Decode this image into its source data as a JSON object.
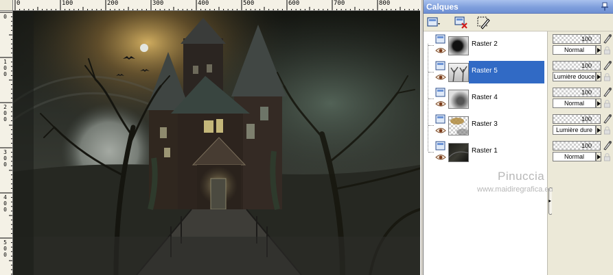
{
  "palette": {
    "title": "Calques",
    "layers": [
      {
        "name": "Raster 2",
        "opacity": "100",
        "blend_mode": "Normal",
        "selected": false,
        "thumb": "dark-smoke"
      },
      {
        "name": "Raster 5",
        "opacity": "100",
        "blend_mode": "Lumière douce",
        "selected": true,
        "thumb": "white-trees"
      },
      {
        "name": "Raster 4",
        "opacity": "100",
        "blend_mode": "Normal",
        "selected": false,
        "thumb": "grey-haze"
      },
      {
        "name": "Raster 3",
        "opacity": "100",
        "blend_mode": "Lumière dure",
        "selected": false,
        "thumb": "clouds"
      },
      {
        "name": "Raster 1",
        "opacity": "100",
        "blend_mode": "Normal",
        "selected": false,
        "thumb": "dark-landscape"
      }
    ]
  },
  "ruler": {
    "top_labels": [
      "0",
      "100",
      "200",
      "300",
      "400",
      "500",
      "600",
      "700",
      "800"
    ],
    "left_labels": [
      [
        "0"
      ],
      [
        "1",
        "0",
        "0"
      ],
      [
        "2",
        "0",
        "0"
      ],
      [
        "3",
        "0",
        "0"
      ],
      [
        "4",
        "0",
        "0"
      ],
      [
        "5",
        "0",
        "0"
      ]
    ]
  },
  "watermark": {
    "title": "Pinuccia",
    "url": "www.maidiregrafica.eu"
  },
  "canvas": {
    "content": "haunted-house-artwork"
  },
  "colors": {
    "selection": "#316ac5",
    "titlebar": "#7f9fdc",
    "panel": "#ece9d8"
  }
}
